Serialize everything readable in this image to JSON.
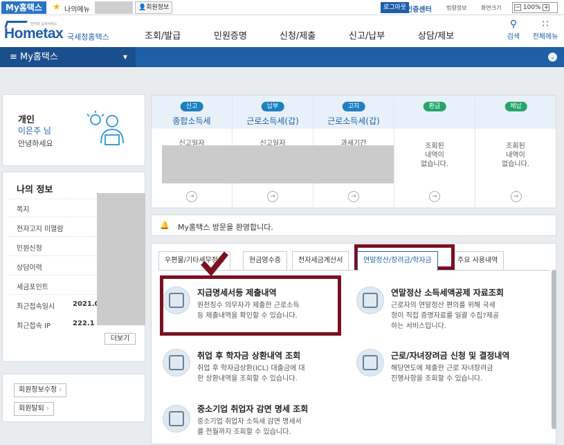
{
  "topbar": {
    "my_hometax": "My홈택스",
    "my_menu": "나의메뉴",
    "member_info": "회원정보",
    "logout": "로그아웃",
    "cert_center": "인증센터",
    "law_info": "법령정보",
    "screen_size": "화면크기",
    "zoom": "100%"
  },
  "header": {
    "tagline": "전자와 납세서비스",
    "logo_text": "Hometax",
    "nts_name": "국세청홈택스",
    "nav": [
      "조회/발급",
      "민원증명",
      "신청/제출",
      "신고/납부",
      "상담/제보"
    ],
    "search": "검색",
    "all_menu": "전체메뉴"
  },
  "mybar": {
    "title": "≡  My홈택스"
  },
  "user": {
    "type": "개인",
    "name": "이은주 님",
    "greeting": "안녕하세요"
  },
  "myinfo": {
    "title": "나의 정보",
    "items": [
      "쪽지",
      "전자고지 미열람",
      "민원신청",
      "상담이력",
      "세금포인트",
      "최근접속일시",
      "최근접속 IP"
    ],
    "last_login_partial": "2021.0",
    "last_ip_partial": "222.1",
    "more": "더보기"
  },
  "account": {
    "edit": "회원정보수정",
    "withdraw": "회원탈퇴"
  },
  "summary": [
    {
      "badge": "신고",
      "name": "종합소득세",
      "label": "신고일자",
      "empty": ""
    },
    {
      "badge": "납부",
      "name": "근로소득세(갑)",
      "label": "신고일자",
      "empty": ""
    },
    {
      "badge": "고지",
      "name": "근로소득세(갑)",
      "label": "과세기간",
      "empty": ""
    },
    {
      "badge": "환급",
      "name": "",
      "label": "",
      "empty": "조회된\n내역이\n없습니다."
    },
    {
      "badge": "체납",
      "name": "",
      "label": "",
      "empty": "조회된\n내역이\n없습니다."
    }
  ],
  "welcome": "My홈택스 방문을 환영합니다.",
  "tabs": [
    "우편물/기타세무정보",
    "현금영수증",
    "전자세금계산서",
    "연말정산/장려금/학자금",
    "주요 사용내역"
  ],
  "services": [
    {
      "title": "지급명세서등 제출내역",
      "desc": [
        "원천징수 의무자가 제출한 근로소득",
        "등 제출내역을 확인할 수 있습니다."
      ]
    },
    {
      "title": "연말정산 소득세액공제 자료조회",
      "desc": [
        "근로자의 연말정산 편의를 위해 국세",
        "청이 직접 증명자료를 일괄 수집?제공",
        "하는 서비스입니다."
      ]
    },
    {
      "title": "취업 후 학자금 상환내역 조회",
      "desc": [
        "취업 후 학자금상환(ICL) 대출금에 대",
        "한 상환내역을 조회할 수 있습니다."
      ]
    },
    {
      "title": "근로/자녀장려금 신청 및 결정내역",
      "desc": [
        "해당연도에 제출한 근로 자녀장려금",
        "진행사항을 조회할 수 있습니다."
      ]
    },
    {
      "title": "중소기업 취업자 감면 명세 조회",
      "desc": [
        "중소기업 취업자 소득세 감면 명세서",
        "를 전월까지 조회할 수 있습니다."
      ]
    }
  ],
  "colors": {
    "brand": "#1f5fa8",
    "highlight": "#7a1020",
    "badge_blue": "#1f7fc0",
    "badge_green": "#26a56a"
  }
}
